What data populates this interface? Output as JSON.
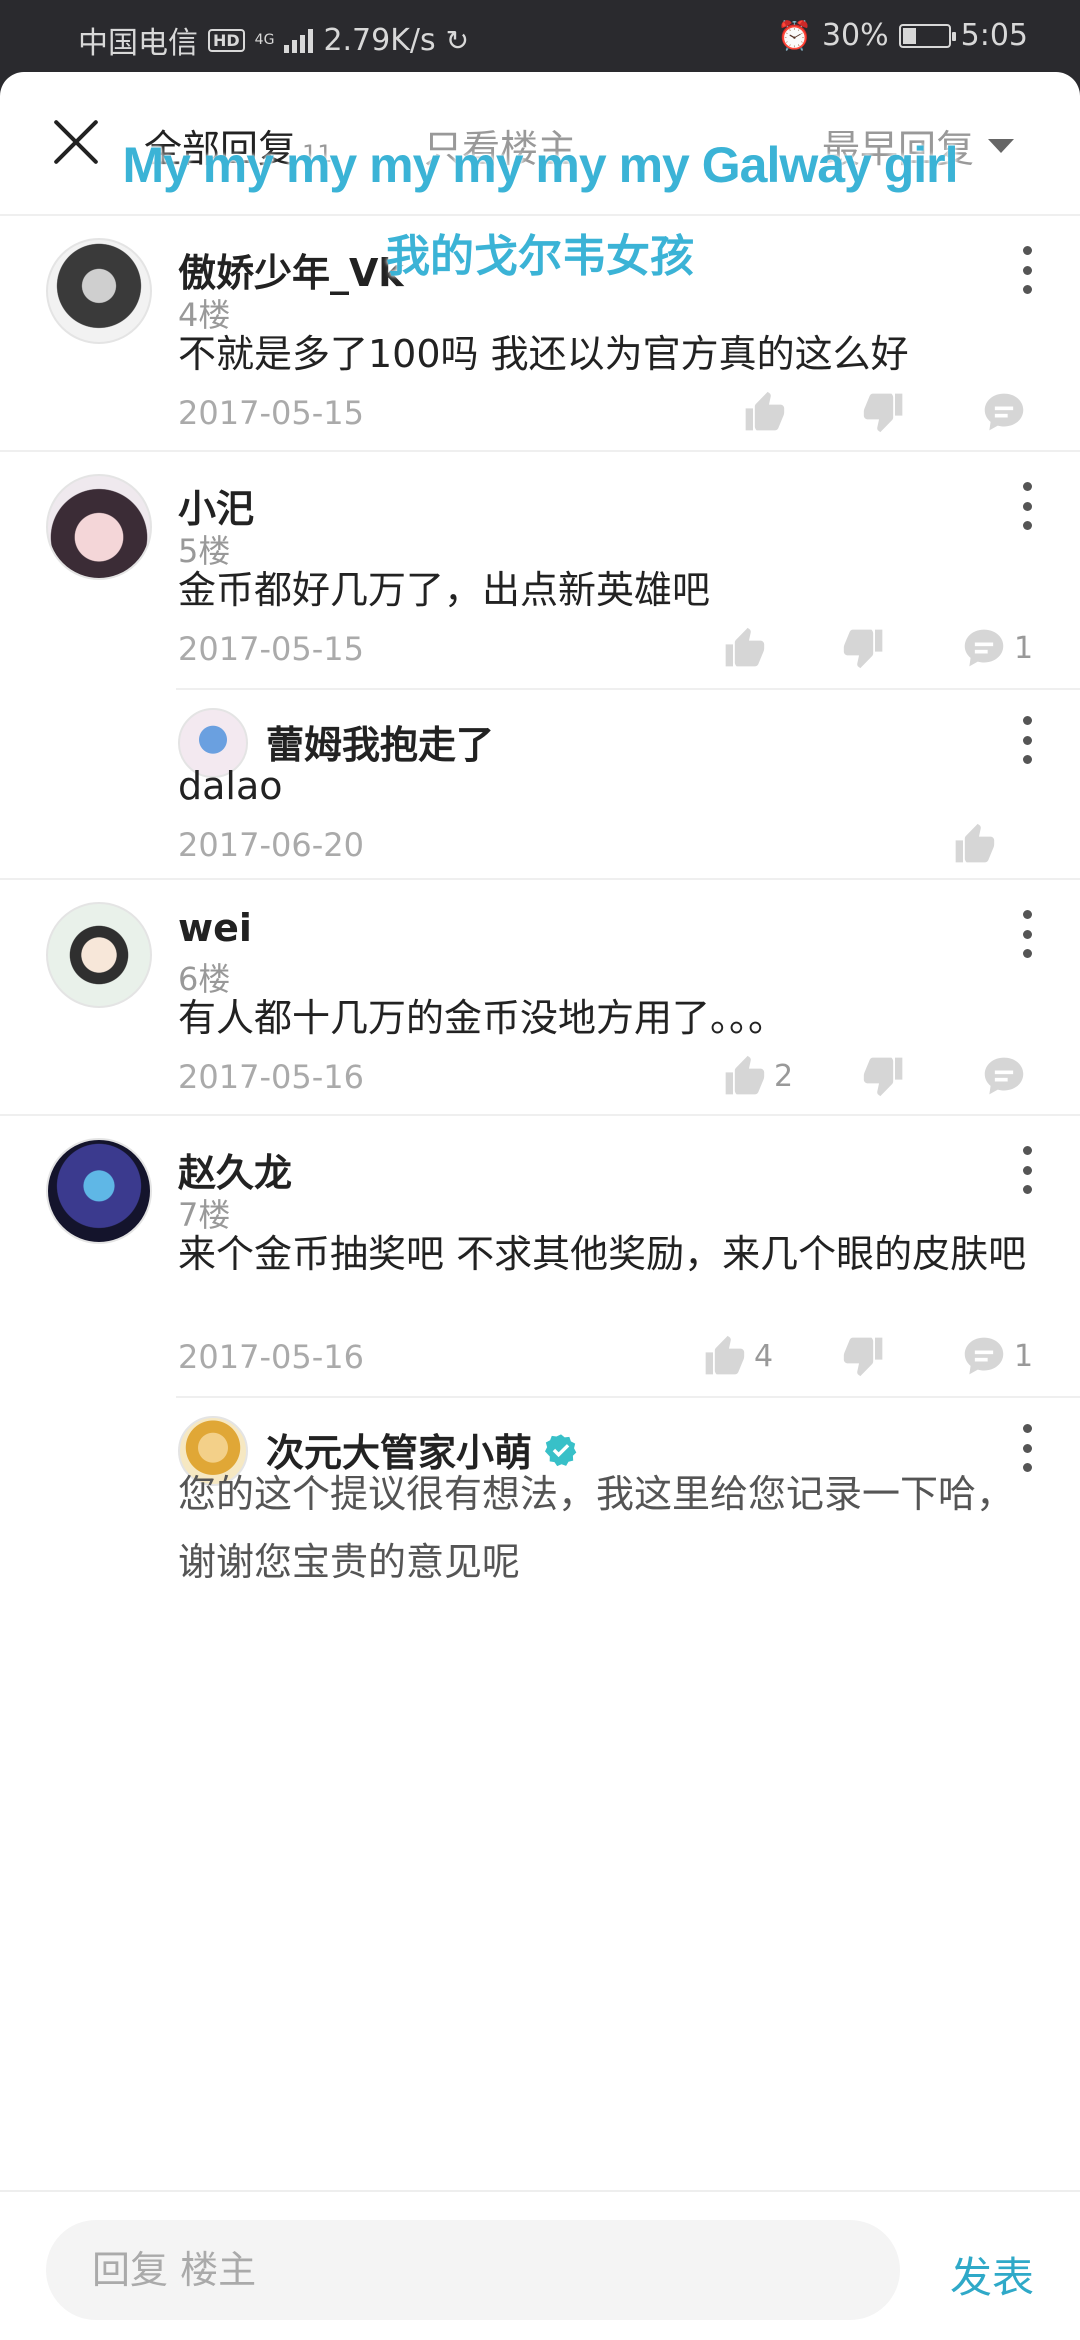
{
  "status_bar": {
    "carrier": "中国电信",
    "hd": "HD",
    "network": "4G",
    "speed": "2.79K/s",
    "battery": "30%",
    "battery_level": 0.3,
    "time": "5:05"
  },
  "header": {
    "tab_all_label": "全部回复",
    "tab_all_count": "11",
    "tab_owner_label": "只看楼主",
    "sort_label": "最早回复"
  },
  "overlay": {
    "english": "My my my my my my my Galway girl",
    "chinese": "我的戈尔韦女孩"
  },
  "comments": [
    {
      "name": "傲娇少年_Vk",
      "floor": "4楼",
      "content": "不就是多了100吗   我还以为官方真的这么好",
      "date": "2017-05-15",
      "likes": "",
      "replies": ""
    },
    {
      "name": "小汜",
      "floor": "5楼",
      "content": "金币都好几万了，出点新英雄吧",
      "date": "2017-05-15",
      "likes": "",
      "replies": "1",
      "reply": {
        "name": "蕾姆我抱走了",
        "content": "dalao",
        "date": "2017-06-20"
      }
    },
    {
      "name": "wei",
      "floor": "6楼",
      "content": "有人都十几万的金币没地方用了。。。",
      "date": "2017-05-16",
      "likes": "2",
      "replies": ""
    },
    {
      "name": "赵久龙",
      "floor": "7楼",
      "content": "来个金币抽奖吧 不求其他奖励，来几个眼的皮肤吧",
      "date": "2017-05-16",
      "likes": "4",
      "replies": "1",
      "reply": {
        "name": "次元大管家小萌",
        "content": "您的这个提议很有想法，我这里给您记录一下哈，谢谢您宝贵的意见呢"
      }
    }
  ],
  "bottom_bar": {
    "placeholder": "回复  楼主",
    "publish_label": "发表"
  },
  "colors": {
    "accent": "#2fa9c8",
    "overlay_text": "#3bb3d6",
    "verified": "#38c0c8"
  }
}
